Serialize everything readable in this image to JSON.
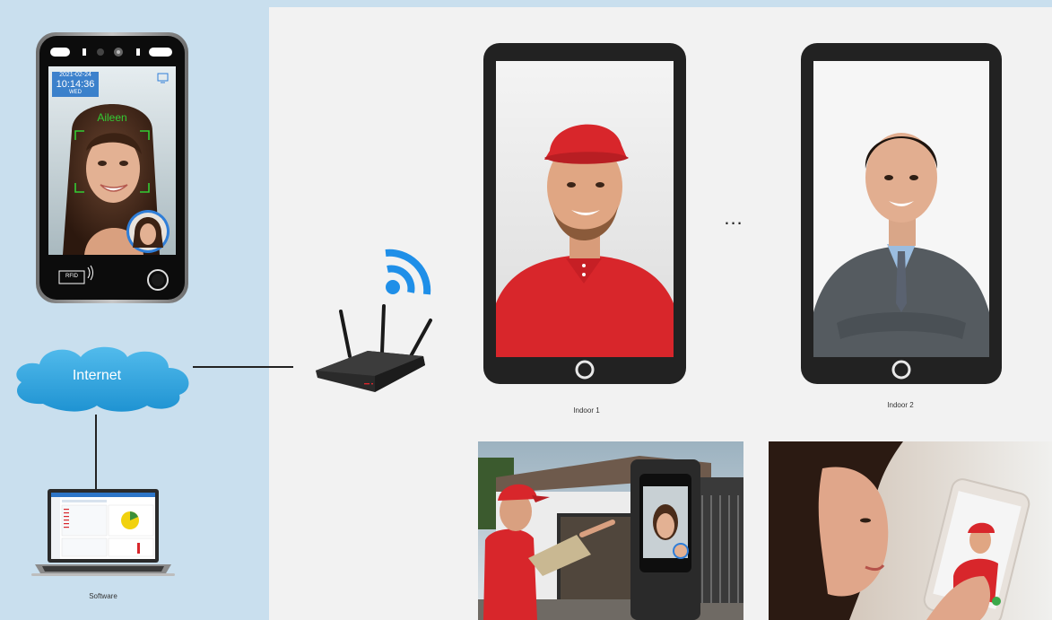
{
  "terminal": {
    "date": "2021-02-24",
    "time": "10:14:36",
    "weekday": "WED",
    "recognized_name": "Aileen",
    "rfid_label": "RFID"
  },
  "network": {
    "internet_label": "Internet",
    "software_label": "Software"
  },
  "indoor_units": [
    {
      "label": "Indoor 1"
    },
    {
      "label": "Indoor 2"
    }
  ],
  "ellipsis": "...",
  "colors": {
    "panel_bg": "#c9dfee",
    "cloud_blue": "#2ea3dc",
    "wifi_blue": "#1f8fe8",
    "face_frame_green": "#33cc33",
    "accent_red": "#d8262b"
  }
}
